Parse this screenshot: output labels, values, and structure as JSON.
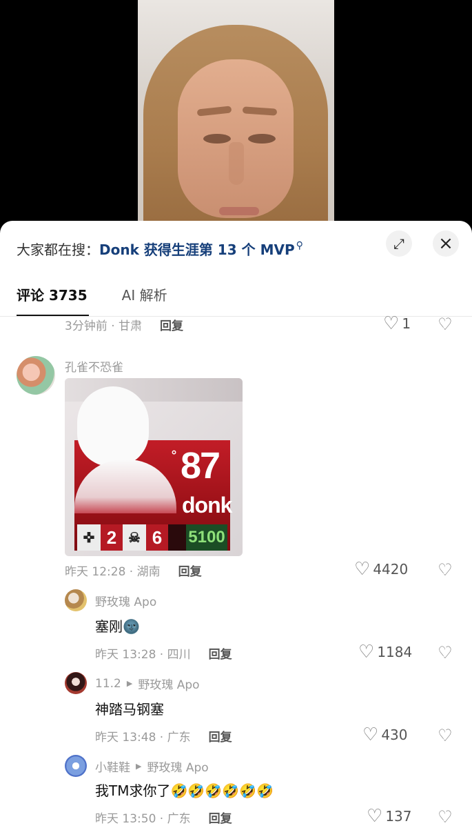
{
  "header": {
    "search_prefix": "大家都在搜：",
    "search_keyword": "Donk 获得生涯第 13 个 MVP",
    "search_icon": "search-icon",
    "expand_icon": "expand-icon",
    "close_icon": "close-icon"
  },
  "tabs": [
    {
      "label": "评论 3735",
      "active": true
    },
    {
      "label": "AI 解析",
      "active": false
    }
  ],
  "comments": {
    "prev": {
      "time_location": "3分钟前 · 甘肃",
      "reply_label": "回复",
      "likes": "1"
    },
    "main": {
      "username": "孔雀不恐雀",
      "image": {
        "rating": "87",
        "player": "donk",
        "stat1": "2",
        "stat2": "6",
        "money": "5100"
      },
      "time_location": "昨天 12:28 · 湖南",
      "reply_label": "回复",
      "likes": "4420"
    },
    "replies": [
      {
        "username": "野玫瑰 Apo",
        "reply_to": "",
        "text": "塞刚🌚",
        "time_location": "昨天 13:28 · 四川",
        "reply_label": "回复",
        "likes": "1184"
      },
      {
        "username": "11.2",
        "reply_to": "野玫瑰 Apo",
        "text": "神踏马钢塞",
        "time_location": "昨天 13:48 · 广东",
        "reply_label": "回复",
        "likes": "430"
      },
      {
        "username": "小鞋鞋",
        "reply_to": "野玫瑰 Apo",
        "text": "我TM求你了🤣🤣🤣🤣🤣🤣",
        "time_location": "昨天 13:50 · 广东",
        "reply_label": "回复",
        "likes": "137"
      }
    ]
  },
  "colors": {
    "search_keyword": "#163f7a",
    "muted_text": "#9a9a9a",
    "card_red": "#c21d27"
  }
}
